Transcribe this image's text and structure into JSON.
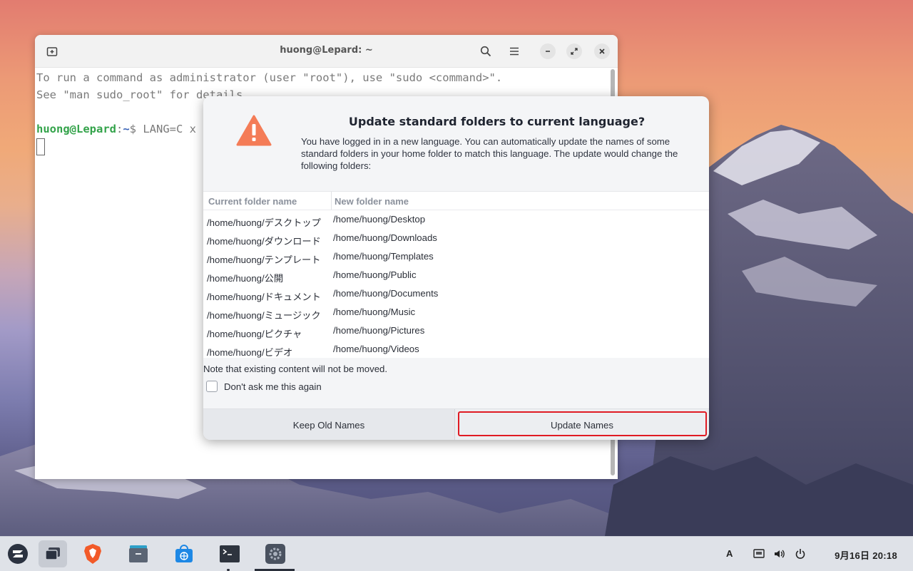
{
  "terminal": {
    "title": "huong@Lepard: ~",
    "lines": [
      "To run a command as administrator (user \"root\"), use \"sudo <command>\".",
      "See \"man sudo_root\" for details."
    ],
    "prompt_user": "huong@Lepard",
    "prompt_sep": ":",
    "prompt_path": "~",
    "prompt_cmd": "$ LANG=C x"
  },
  "dialog": {
    "title": "Update standard folders to current language?",
    "description": "You have logged in in a new language. You can automatically update the names of some standard folders in your home folder to match this language. The update would change the following folders:",
    "columns": [
      "Current folder name",
      "New folder name"
    ],
    "rows": [
      [
        "/home/huong/デスクトップ",
        "/home/huong/Desktop"
      ],
      [
        "/home/huong/ダウンロード",
        "/home/huong/Downloads"
      ],
      [
        "/home/huong/テンプレート",
        "/home/huong/Templates"
      ],
      [
        "/home/huong/公開",
        "/home/huong/Public"
      ],
      [
        "/home/huong/ドキュメント",
        "/home/huong/Documents"
      ],
      [
        "/home/huong/ミュージック",
        "/home/huong/Music"
      ],
      [
        "/home/huong/ピクチャ",
        "/home/huong/Pictures"
      ],
      [
        "/home/huong/ビデオ",
        "/home/huong/Videos"
      ]
    ],
    "note": "Note that existing content will not be moved.",
    "checkbox_label": "Don't ask me this again",
    "btn_keep": "Keep Old Names",
    "btn_update": "Update Names"
  },
  "taskbar": {
    "input_indicator": "A",
    "clock": "9月16日  20:18",
    "apps": [
      "zorin-menu-icon",
      "workspaces-icon",
      "brave-browser-icon",
      "files-icon",
      "software-store-icon",
      "terminal-icon",
      "settings-icon"
    ]
  },
  "colors": {
    "accent_red": "#e01b24",
    "warning_orange": "#f47c57",
    "prompt_green": "#33a34a"
  }
}
